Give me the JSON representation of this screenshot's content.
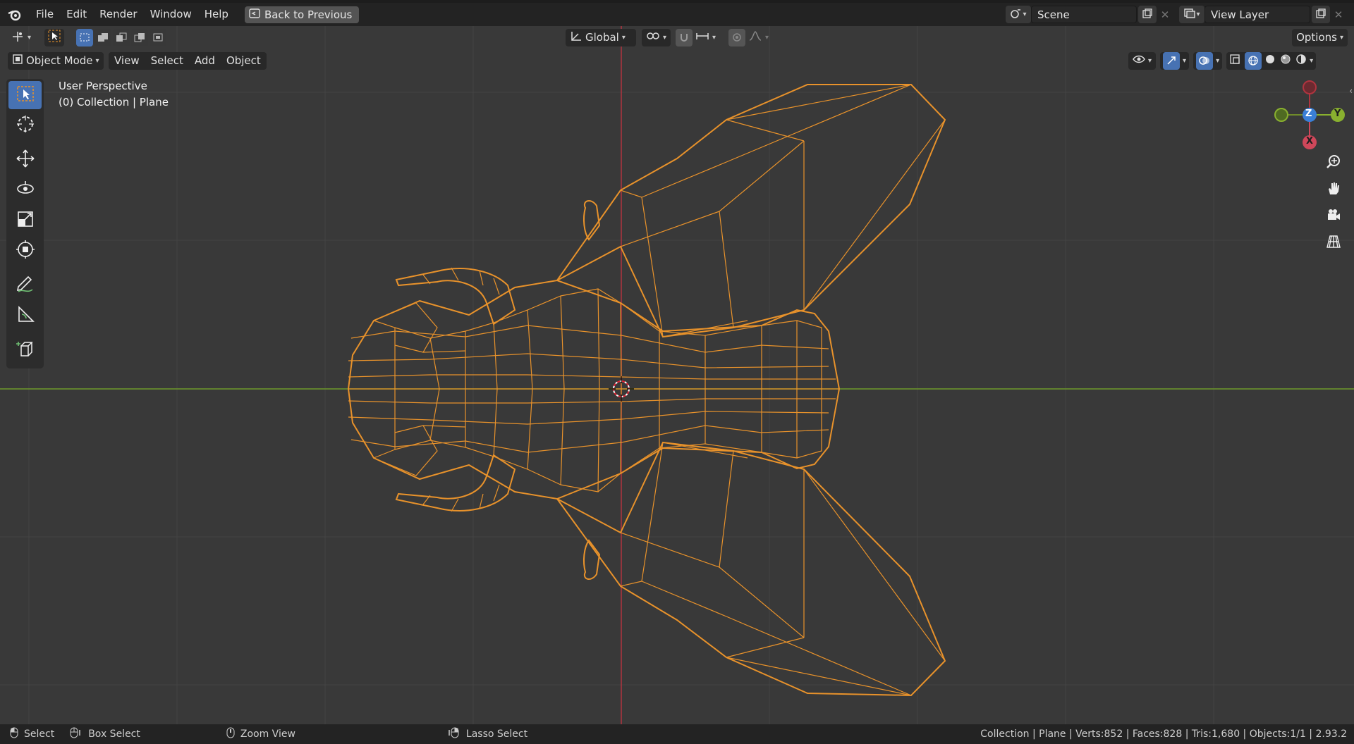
{
  "topbar": {
    "menus": [
      "File",
      "Edit",
      "Render",
      "Window",
      "Help"
    ],
    "back_button": "Back to Previous",
    "scene": "Scene",
    "view_layer": "View Layer"
  },
  "header": {
    "orientation": "Global",
    "options": "Options"
  },
  "viewport_header": {
    "mode": "Object Mode",
    "menus": [
      "View",
      "Select",
      "Add",
      "Object"
    ]
  },
  "overlay": {
    "perspective": "User Perspective",
    "collection": "(0) Collection | Plane"
  },
  "gizmo": {
    "z": "Z",
    "y": "Y",
    "x": "X"
  },
  "statusbar": {
    "select": "Select",
    "box_select": "Box Select",
    "zoom_view": "Zoom View",
    "lasso_select": "Lasso Select",
    "stats": "Collection | Plane | Verts:852 | Faces:828 | Tris:1,680 | Objects:1/1 | 2.93.2"
  },
  "colors": {
    "viewport_bg": "#393939",
    "wire": "#e8922b",
    "x_axis": "#b0343f",
    "y_axis": "#6f9a2a",
    "active_tool": "#4772b3"
  }
}
